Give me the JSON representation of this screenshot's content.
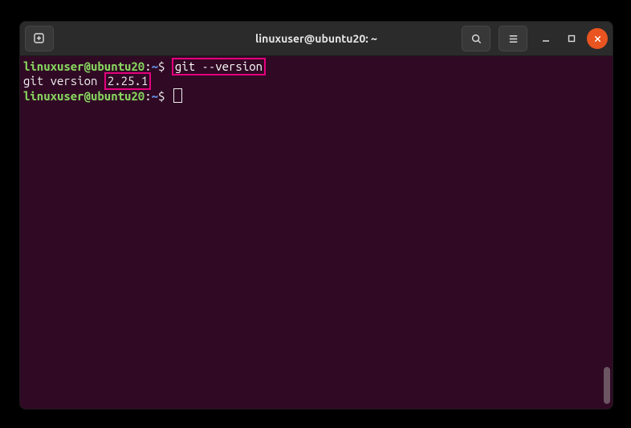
{
  "titlebar": {
    "title": "linuxuser@ubuntu20: ~"
  },
  "prompt": {
    "user_host": "linuxuser@ubuntu20",
    "separator": ":",
    "path": "~",
    "symbol": "$"
  },
  "command1": "git --version",
  "output1_prefix": "git version ",
  "output1_version": "2.25.1",
  "highlight_color": "#e6007e",
  "colors": {
    "terminal_bg": "#300a24",
    "titlebar_bg": "#2b2b2b",
    "prompt_user": "#87d75f",
    "prompt_path": "#5f87d7",
    "close_btn": "#e95420"
  }
}
